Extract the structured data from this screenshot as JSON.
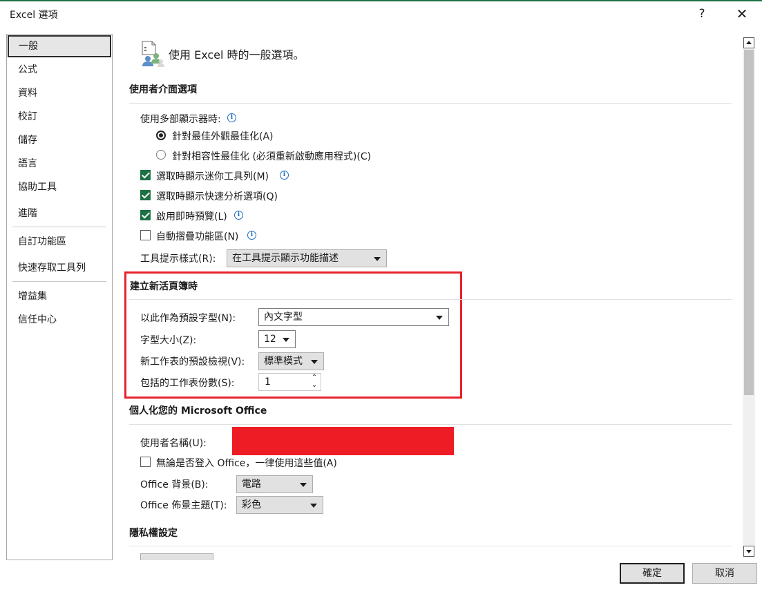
{
  "window": {
    "title": "Excel 選項",
    "help_glyph": "?",
    "close_glyph": "✕"
  },
  "sidebar": {
    "items": [
      {
        "label": "一般",
        "selected": true
      },
      {
        "label": "公式"
      },
      {
        "label": "資料"
      },
      {
        "label": "校訂"
      },
      {
        "label": "儲存"
      },
      {
        "label": "語言"
      },
      {
        "label": "協助工具"
      },
      {
        "label": "進階"
      },
      {
        "label": "自訂功能區"
      },
      {
        "label": "快速存取工具列"
      },
      {
        "label": "增益集"
      },
      {
        "label": "信任中心"
      }
    ]
  },
  "header": {
    "title": "使用 Excel 時的一般選項。",
    "icon": "options-people-icon"
  },
  "ui_options": {
    "section_title": "使用者介面選項",
    "multi_display_label": "使用多部顯示器時:",
    "radio_best_appearance": "針對最佳外觀最佳化(A)",
    "radio_compat": "針對相容性最佳化 (必須重新啟動應用程式)(C)",
    "radio_selected": "best_appearance",
    "mini_toolbar": {
      "label": "選取時顯示迷你工具列(M)",
      "checked": true
    },
    "quick_analysis": {
      "label": "選取時顯示快速分析選項(Q)",
      "checked": true
    },
    "live_preview": {
      "label": "啟用即時預覽(L)",
      "checked": true
    },
    "collapse_ribbon": {
      "label": "自動摺疊功能區(N)",
      "checked": false
    },
    "tooltip_style_label": "工具提示樣式(R):",
    "tooltip_style_value": "在工具提示顯示功能描述"
  },
  "new_workbook": {
    "section_title": "建立新活頁簿時",
    "default_font_label": "以此作為預設字型(N):",
    "default_font_value": "內文字型",
    "font_size_label": "字型大小(Z):",
    "font_size_value": "12",
    "default_view_label": "新工作表的預設檢視(V):",
    "default_view_value": "標準模式",
    "sheet_count_label": "包括的工作表份數(S):",
    "sheet_count_value": "1"
  },
  "personalize": {
    "section_title": "個人化您的 Microsoft Office",
    "username_label": "使用者名稱(U):",
    "always_use_label": "無論是否登入 Office，一律使用這些值(A)",
    "always_use_checked": false,
    "background_label": "Office 背景(B):",
    "background_value": "電路",
    "theme_label": "Office 佈景主題(T):",
    "theme_value": "彩色"
  },
  "privacy": {
    "section_title": "隱私權設定"
  },
  "footer": {
    "ok_label": "確定",
    "cancel_label": "取消"
  },
  "colors": {
    "accent_green": "#1e7145",
    "highlight_red": "#e8202a",
    "redaction_red": "#ee1c25",
    "info_blue": "#1d6cbf"
  }
}
